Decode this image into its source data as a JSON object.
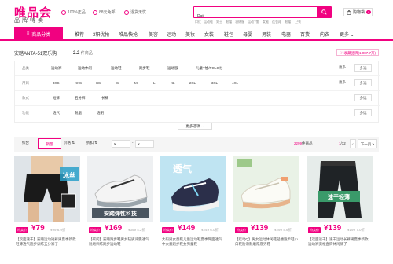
{
  "header": {
    "logo": "唯品会",
    "logo_sub": "品牌特卖",
    "promises": [
      "100%正品",
      "88元免邮",
      "退货无忧"
    ],
    "search": {
      "value": "Dat",
      "placeholder": ""
    },
    "hot_words": [
      "口红",
      "运动鞋",
      "男士",
      "眼霜",
      "羽绒服",
      "运动T恤",
      "女鞋",
      "连衣裙",
      "眼霜",
      "卫衣"
    ],
    "cart_label": "购物袋",
    "cart_count": "0"
  },
  "nav": {
    "category_button": "商品分类",
    "items": [
      "推荐",
      "3积优抢",
      "唯品快抢",
      "美容",
      "运动",
      "美妆",
      "女装",
      "鞋包",
      "母婴",
      "男装",
      "电器",
      "百货",
      "内衣",
      "更多"
    ]
  },
  "breadcrumb": {
    "title": "安踏ANTA-51双乐购",
    "count": "2.2",
    "count_unit": "件商品",
    "favorite": "收藏品牌(1,087.7万)"
  },
  "filters": {
    "rows": [
      {
        "label": "品类",
        "options": [
          "运动裤",
          "运动休闲",
          "运动鞋",
          "跑步鞋",
          "运动服",
          "儿童T恤/POLO衫"
        ],
        "more": "更多",
        "multi": "多选"
      },
      {
        "label": "尺码",
        "options": [
          "3XS",
          "XXS",
          "XS",
          "S",
          "M",
          "L",
          "XL",
          "2XL",
          "3XL",
          "4XL"
        ],
        "more": "更多",
        "multi": "多选"
      },
      {
        "label": "款式",
        "options": [
          "短裤",
          "五分裤",
          "长裤"
        ],
        "more": "",
        "multi": "多选"
      },
      {
        "label": "功能",
        "options": [
          "透气",
          "耐磨",
          "透明"
        ],
        "more": "",
        "multi": "多选"
      }
    ],
    "show_more": "更多选项"
  },
  "sortbar": {
    "items": [
      "综合",
      "销量",
      "价格",
      "折扣"
    ],
    "active": "销量",
    "price_from": "¥",
    "price_to": "¥",
    "total_count": "2299",
    "total_unit": "件商品",
    "page_current": "1",
    "page_total": "/12",
    "prev": "<",
    "next": "下一页 >"
  },
  "products": [
    {
      "tag": "特卖价",
      "price": "¥79",
      "orig": "¥99 6.0折",
      "title": "【双面速干】安踏运动短裤男夏季新款轻薄透气跑步训练五分裤子",
      "badge_text": "冰丝"
    },
    {
      "tag": "特卖价",
      "price": "¥169",
      "orig": "¥399 4.2折",
      "title": "【碳闪】安踏跑步鞋男女轻质减震透气耐磨训练跑步运动鞋",
      "badge_text": "安踏弹性科技"
    },
    {
      "tag": "特卖价",
      "price": "¥149",
      "orig": "¥249 6.0折",
      "title": "大码男女童鞋儿童运动鞋夏季网面透气中大童跑步鞋女男童鞋",
      "badge_text": "透气"
    },
    {
      "tag": "特卖价",
      "price": "¥139",
      "orig": "¥299 4.6折",
      "title": "【跃动Q】男女运动休闲鞋轻便跑步鞋小白鞋防滑耐磨厚底男鞋",
      "badge_text": ""
    },
    {
      "tag": "特卖价",
      "price": "¥139",
      "orig": "¥199 7.0折",
      "title": "【双面速干】速干运动长裤男夏季新款运动裤宽松直筒休闲裤子",
      "badge_text": "速干轻薄"
    }
  ],
  "colors": {
    "brand": "#f10180"
  }
}
